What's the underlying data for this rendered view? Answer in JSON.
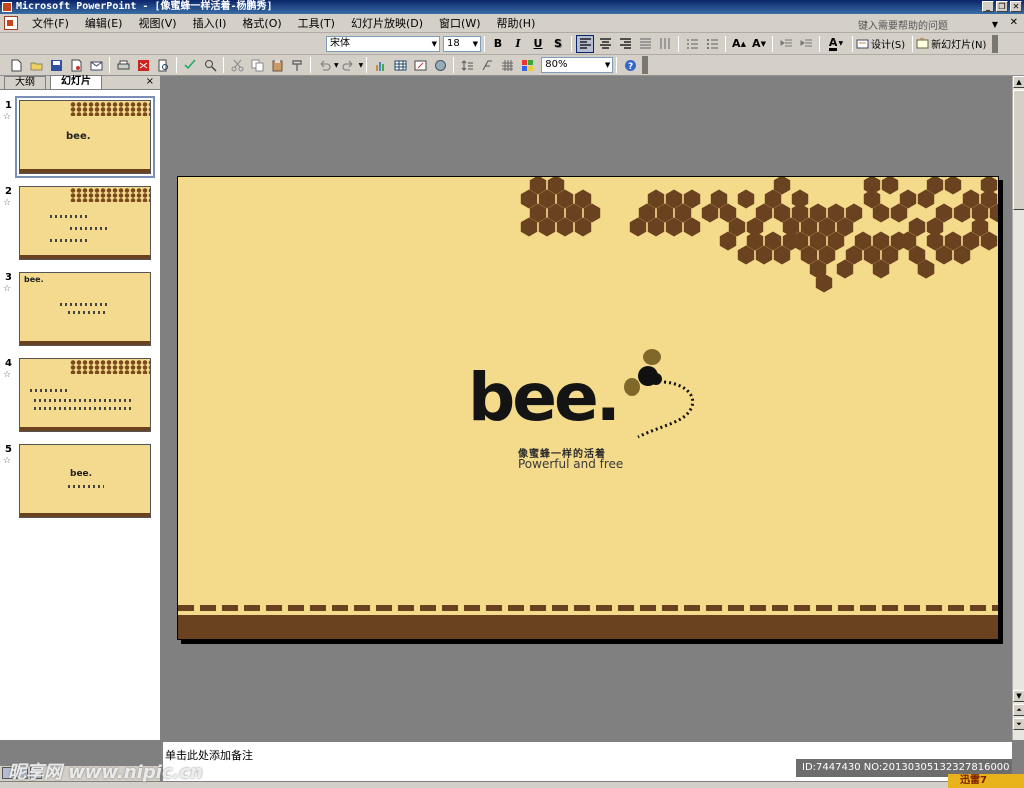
{
  "window": {
    "title": "Microsoft PowerPoint - [像蜜蜂一样活着-杨鹏秀]",
    "buttons": [
      "_",
      "❐",
      "✕"
    ]
  },
  "menubar": {
    "items": [
      "文件(F)",
      "编辑(E)",
      "视图(V)",
      "插入(I)",
      "格式(O)",
      "工具(T)",
      "幻灯片放映(D)",
      "窗口(W)",
      "帮助(H)"
    ],
    "help_placeholder": "键入需要帮助的问题",
    "close": "✕"
  },
  "formatting_toolbar": {
    "font": "宋体",
    "size": "18",
    "bold": "B",
    "italic": "I",
    "underline": "U",
    "shadow": "S",
    "design_label": "设计(S)",
    "new_slide_label": "新幻灯片(N)"
  },
  "standard_toolbar": {
    "zoom": "80%"
  },
  "outline_panel": {
    "tabs": [
      "大纲",
      "幻灯片"
    ],
    "close": "×",
    "slides": [
      {
        "number": "1",
        "star": "☆",
        "text": "bee."
      },
      {
        "number": "2",
        "star": "☆",
        "text": ""
      },
      {
        "number": "3",
        "star": "☆",
        "text": "bee."
      },
      {
        "number": "4",
        "star": "☆",
        "text": ""
      },
      {
        "number": "5",
        "star": "☆",
        "text": "bee."
      }
    ]
  },
  "slide": {
    "logo_text": "bee.",
    "subtitle_cn": "像蜜蜂一样的活着",
    "subtitle_en": "Powerful and free",
    "background_color": "#f4da8b",
    "accent_color": "#6b4220"
  },
  "notes": {
    "placeholder": "单击此处添加备注"
  },
  "overlays": {
    "watermark": "昵享网 www.nipic.cn",
    "id_stamp": "ID:7447430 NO:20130305132327816000",
    "corner_logo": "迅雷7"
  }
}
